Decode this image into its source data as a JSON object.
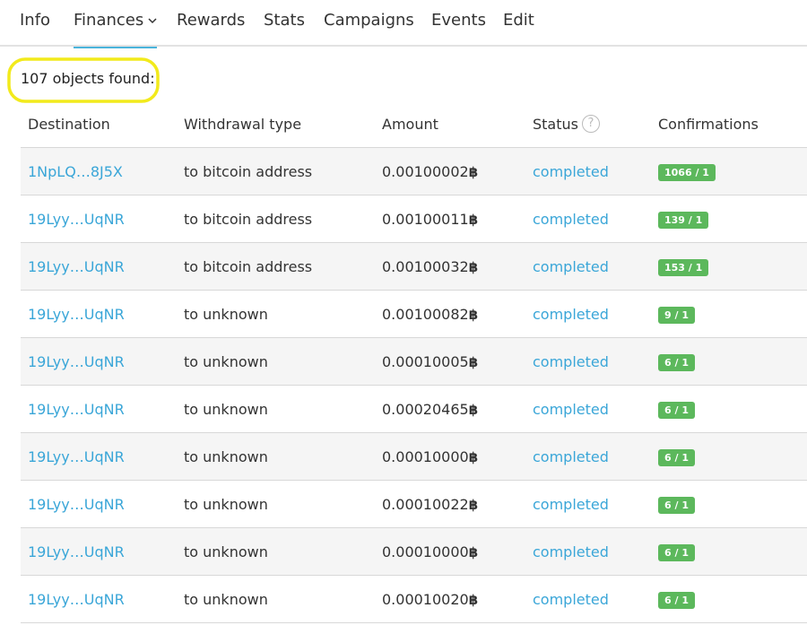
{
  "tabs": [
    "Info",
    "Finances",
    "Rewards",
    "Stats",
    "Campaigns",
    "Events",
    "Edit"
  ],
  "active_tab": "Finances",
  "results": {
    "found_text": "107 objects found:"
  },
  "table": {
    "headers": {
      "destination": "Destination",
      "withdrawal_type": "Withdrawal type",
      "amount": "Amount",
      "status": "Status",
      "status_help": "?",
      "confirmations": "Confirmations"
    },
    "currency_symbol": "฿",
    "rows": [
      {
        "destination": "1NpLQ…8J5X",
        "type": "to bitcoin address",
        "amount": "0.00100002",
        "status": "completed",
        "confirmations": "1066 / 1"
      },
      {
        "destination": "19Lyy…UqNR",
        "type": "to bitcoin address",
        "amount": "0.00100011",
        "status": "completed",
        "confirmations": "139 / 1"
      },
      {
        "destination": "19Lyy…UqNR",
        "type": "to bitcoin address",
        "amount": "0.00100032",
        "status": "completed",
        "confirmations": "153 / 1"
      },
      {
        "destination": "19Lyy…UqNR",
        "type": "to unknown",
        "amount": "0.00100082",
        "status": "completed",
        "confirmations": "9 / 1"
      },
      {
        "destination": "19Lyy…UqNR",
        "type": "to unknown",
        "amount": "0.00010005",
        "status": "completed",
        "confirmations": "6 / 1"
      },
      {
        "destination": "19Lyy…UqNR",
        "type": "to unknown",
        "amount": "0.00020465",
        "status": "completed",
        "confirmations": "6 / 1"
      },
      {
        "destination": "19Lyy…UqNR",
        "type": "to unknown",
        "amount": "0.00010000",
        "status": "completed",
        "confirmations": "6 / 1"
      },
      {
        "destination": "19Lyy…UqNR",
        "type": "to unknown",
        "amount": "0.00010022",
        "status": "completed",
        "confirmations": "6 / 1"
      },
      {
        "destination": "19Lyy…UqNR",
        "type": "to unknown",
        "amount": "0.00010000",
        "status": "completed",
        "confirmations": "6 / 1"
      },
      {
        "destination": "19Lyy…UqNR",
        "type": "to unknown",
        "amount": "0.00010020",
        "status": "completed",
        "confirmations": "6 / 1"
      }
    ]
  },
  "colors": {
    "link": "#3aa6d8",
    "badge": "#5cb85c",
    "highlight": "#f2ea1c",
    "tab_underline": "#4ab4db"
  }
}
